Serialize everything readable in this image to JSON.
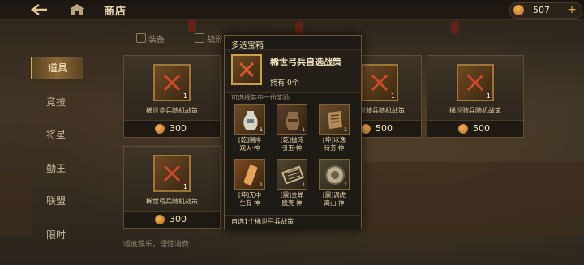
{
  "topbar": {
    "title": "商店",
    "currency_amount": "507",
    "plus": "+"
  },
  "nav": [
    {
      "label": "道具",
      "active": true
    },
    {
      "label": "竞技",
      "active": false
    },
    {
      "label": "将星",
      "active": false
    },
    {
      "label": "勤王",
      "active": false
    },
    {
      "label": "联盟",
      "active": false
    },
    {
      "label": "限时",
      "active": false
    }
  ],
  "subtabs": [
    {
      "label": "装备"
    },
    {
      "label": "战形"
    }
  ],
  "cards": [
    {
      "name": "稀世步兵随机战策",
      "price": "300",
      "count": "1"
    },
    {
      "name": "稀世弓兵随机战策",
      "price": "300",
      "count": "1"
    },
    {
      "name": "稀世骑兵随机战策",
      "price": "500",
      "count": "1"
    },
    {
      "name": "稀世骑兵随机战策",
      "price": "500",
      "count": "1"
    }
  ],
  "footer_note": "适度娱乐，理性消费",
  "popup": {
    "title": "多选宝箱",
    "item_name": "稀世弓兵自选战策",
    "owned": "拥有:0个",
    "hint": "可选择其中一份奖励",
    "choices": [
      {
        "line1": "[乾]隔岸",
        "line2": "观火·神",
        "count": "1"
      },
      {
        "line1": "[乾]抛砖",
        "line2": "引玉·神",
        "count": "1"
      },
      {
        "line1": "[坤]以逸",
        "line2": "待劳·神",
        "count": "1"
      },
      {
        "line1": "[坤]无中",
        "line2": "生有·神",
        "count": "1"
      },
      {
        "line1": "[震]金蝉",
        "line2": "脱壳·神",
        "count": "1"
      },
      {
        "line1": "[震]调虎",
        "line2": "离山·神",
        "count": "1"
      }
    ],
    "footer": "自选1个稀世弓兵战策"
  },
  "colors": {
    "accent_gold": "#c9a04a",
    "coin": "#e09a3e",
    "active_nav": "#8a6a35"
  }
}
